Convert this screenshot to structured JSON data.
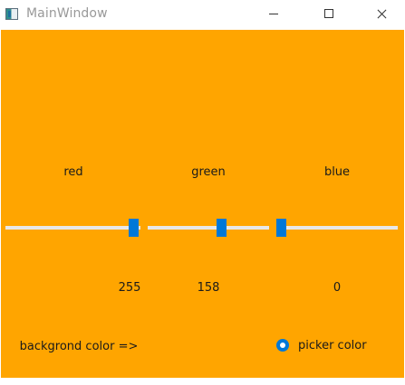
{
  "window": {
    "title": "MainWindow",
    "background_color": "#ffa500",
    "accent_color": "#0078d7"
  },
  "titlebar": {
    "icon": "app-window-icon",
    "minimize_icon": "minimize-icon",
    "maximize_icon": "maximize-icon",
    "close_icon": "close-icon"
  },
  "sliders": [
    {
      "label": "red",
      "value": "255"
    },
    {
      "label": "green",
      "value": "158"
    },
    {
      "label": "blue",
      "value": "0"
    }
  ],
  "background_label": "backgrond color =>",
  "picker": {
    "label": "picker color",
    "checked": true
  }
}
